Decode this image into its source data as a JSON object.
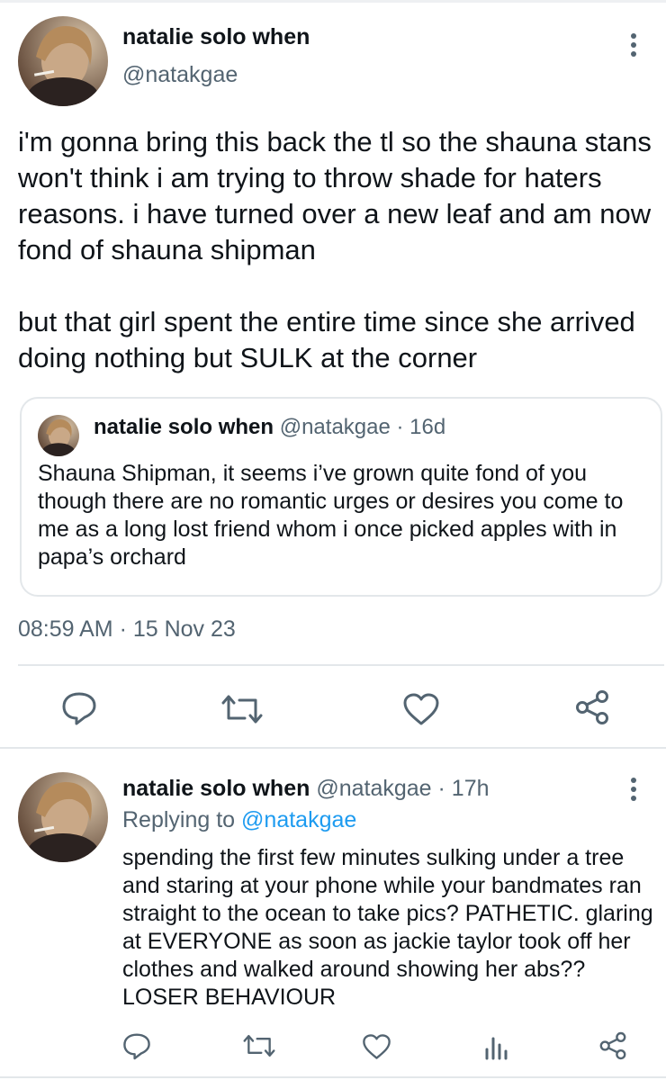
{
  "main_tweet": {
    "author_name": "natalie solo when",
    "author_handle": "@natakgae",
    "paragraph_1": "i'm gonna bring this back the tl so the shauna stans won't think i am trying to throw shade for haters reasons. i have turned over a new leaf and am now fond of shauna shipman",
    "paragraph_2": "but that girl spent the entire time since she arrived doing nothing but SULK at the corner",
    "quoted": {
      "author_name": "natalie solo when",
      "author_handle": "@natakgae",
      "time": "· 16d",
      "text": "Shauna Shipman, it seems i’ve grown quite fond of you though there are no romantic urges or desires you come to me as a long lost friend whom i once picked apples with in papa’s orchard"
    },
    "timestamp": "08:59 AM · 15 Nov 23",
    "actions": [
      "reply-icon",
      "retweet-icon",
      "like-icon",
      "share-icon"
    ]
  },
  "reply_tweet": {
    "author_name": "natalie solo when",
    "author_handle": "@natakgae",
    "time": "· 17h",
    "replying_label": "Replying to",
    "replying_to": "@natakgae",
    "text": "spending the first few minutes sulking under a tree and staring at your phone while your bandmates ran straight to the ocean to take pics? PATHETIC. glaring at EVERYONE as soon as jackie taylor took off her clothes and walked around showing her abs?? LOSER BEHAVIOUR",
    "actions": [
      "reply-icon",
      "retweet-icon",
      "like-icon",
      "analytics-icon",
      "share-icon"
    ]
  },
  "colors": {
    "text": "#0f1419",
    "secondary": "#536471",
    "link": "#1d9bf0",
    "divider": "#e3e7ea"
  }
}
